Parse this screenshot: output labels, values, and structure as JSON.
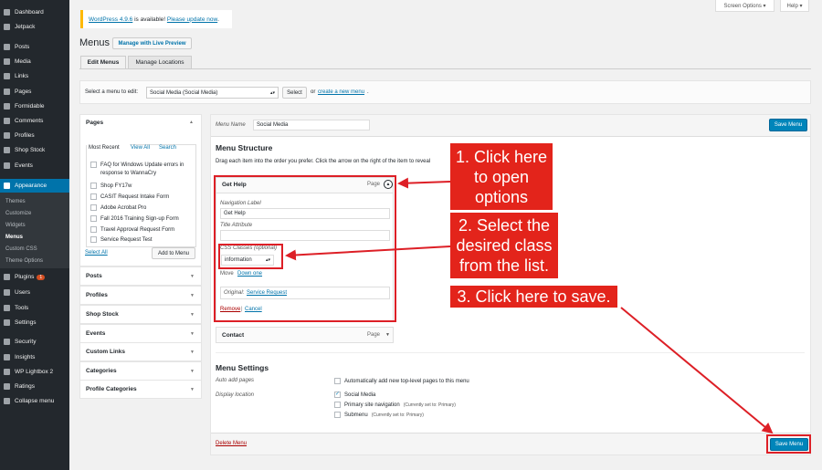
{
  "sidebar": {
    "items": [
      {
        "label": "Dashboard",
        "icon": "dashboard-icon"
      },
      {
        "label": "Jetpack",
        "icon": "jetpack-icon"
      },
      {
        "label": "Posts",
        "icon": "pushpin-icon"
      },
      {
        "label": "Media",
        "icon": "media-icon"
      },
      {
        "label": "Links",
        "icon": "link-icon"
      },
      {
        "label": "Pages",
        "icon": "pages-icon"
      },
      {
        "label": "Formidable",
        "icon": "formidable-icon"
      },
      {
        "label": "Comments",
        "icon": "comment-icon"
      },
      {
        "label": "Profiles",
        "icon": "pushpin-icon"
      },
      {
        "label": "Shop Stock",
        "icon": "pushpin-icon"
      },
      {
        "label": "Events",
        "icon": "pushpin-icon"
      },
      {
        "label": "Appearance",
        "icon": "paintbrush-icon"
      },
      {
        "label": "Plugins",
        "icon": "plugin-icon",
        "badge": "1"
      },
      {
        "label": "Users",
        "icon": "users-icon"
      },
      {
        "label": "Tools",
        "icon": "tools-icon"
      },
      {
        "label": "Settings",
        "icon": "settings-icon"
      },
      {
        "label": "Security",
        "icon": "shield-icon"
      },
      {
        "label": "Insights",
        "icon": "insights-icon"
      },
      {
        "label": "WP Lightbox 2",
        "icon": "lightbox-icon"
      },
      {
        "label": "Ratings",
        "icon": "star-icon"
      },
      {
        "label": "Collapse menu",
        "icon": "collapse-icon"
      }
    ],
    "appearance_sub": [
      "Themes",
      "Customize",
      "Widgets",
      "Menus",
      "Custom CSS",
      "Theme Options"
    ]
  },
  "topbar": {
    "screen_options": "Screen Options ▾",
    "help": "Help ▾"
  },
  "notice": {
    "link1": "WordPress 4.9.6",
    "middle": " is available! ",
    "link2": "Please update now",
    "end": "."
  },
  "page": {
    "title": "Menus",
    "live_preview": "Manage with Live Preview"
  },
  "tabs": [
    "Edit Menus",
    "Manage Locations"
  ],
  "select_menu": {
    "label": "Select a menu to edit:",
    "value": "Social Media (Social Media)",
    "button": "Select",
    "or_text": "or",
    "create_link": "create a new menu",
    "period": "."
  },
  "left": {
    "pages_title": "Pages",
    "subtabs": [
      "Most Recent",
      "View All",
      "Search"
    ],
    "pages": [
      "FAQ for Windows Update errors in response to WannaCry",
      "Shop FY17w",
      "CASIT Request Intake Form",
      "Adobe Acrobat Pro",
      "Fall 2016 Training Sign-up Form",
      "Travel Approval Request Form",
      "Service Request Test"
    ],
    "select_all": "Select All",
    "add_to_menu": "Add to Menu",
    "accordions": [
      "Posts",
      "Profiles",
      "Shop Stock",
      "Events",
      "Custom Links",
      "Categories",
      "Profile Categories"
    ]
  },
  "menu": {
    "name_label": "Menu Name",
    "name_value": "Social Media",
    "save": "Save Menu",
    "structure_title": "Menu Structure",
    "structure_help": "Drag each item into the order you prefer. Click the arrow on the right of the item to reveal",
    "item1": {
      "title": "Get Help",
      "type": "Page",
      "nav_label": "Navigation Label",
      "nav_value": "Get Help",
      "title_attr": "Title Attribute",
      "css_label": "CSS Classes (optional)",
      "css_value": "information",
      "move": "Move",
      "down_one": "Down one",
      "original": "Original:",
      "original_link": "Service Request",
      "remove": "Remove",
      "sep": "|",
      "cancel": "Cancel"
    },
    "item2": {
      "title": "Contact",
      "type": "Page"
    },
    "settings_title": "Menu Settings",
    "auto_add_label": "Auto add pages",
    "auto_add_text": "Automatically add new top-level pages to this menu",
    "display_label": "Display location",
    "locations": [
      {
        "name": "Social Media",
        "note": "",
        "checked": true
      },
      {
        "name": "Primary site navigation",
        "note": "(Currently set to: Primary)",
        "checked": false
      },
      {
        "name": "Submenu",
        "note": "(Currently set to: Primary)",
        "checked": false
      }
    ],
    "delete": "Delete Menu"
  },
  "callouts": {
    "c1": "1. Click here to open options",
    "c2": "2. Select the desired class from the list.",
    "c3": "3. Click here to save."
  },
  "colors": {
    "accent": "#0073aa",
    "sidebar": "#23282d",
    "callout": "#e3241b",
    "primary": "#0085ba"
  }
}
